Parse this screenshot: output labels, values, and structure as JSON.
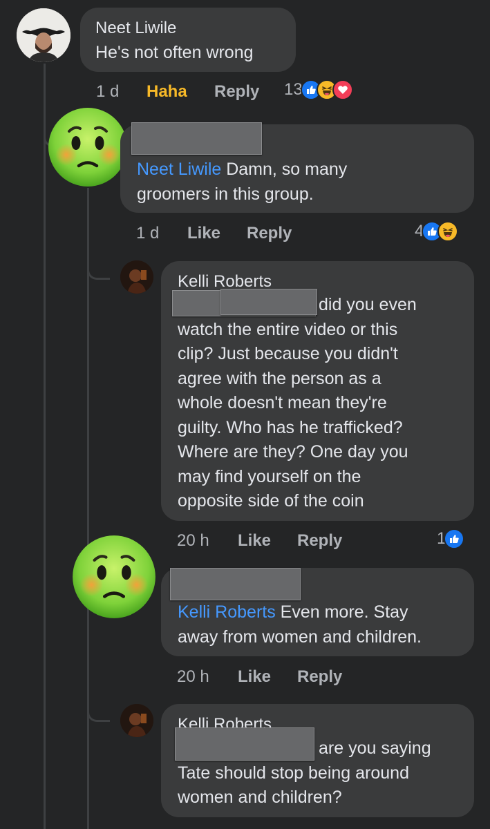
{
  "comments": [
    {
      "author": "Neet Liwile",
      "text": "He's not often wrong",
      "time": "1 d",
      "reaction_label": "Haha",
      "reply_label": "Reply",
      "reaction_count": "13",
      "reaction_icons": [
        "like-icon",
        "haha-icon",
        "love-icon"
      ]
    },
    {
      "author": "",
      "mention": "Neet Liwile",
      "text_line1": " Damn, so many",
      "text_line2": "groomers in this group.",
      "time": "1 d",
      "like_label": "Like",
      "reply_label": "Reply",
      "reaction_count": "4",
      "reaction_icons": [
        "like-icon",
        "haha-icon"
      ]
    },
    {
      "author": "Kelli Roberts",
      "text_lines": [
        "did you even",
        "watch the entire video or this",
        "clip? Just because you didn't",
        "agree with the person as a",
        "whole doesn't mean they're",
        "guilty. Who has he trafficked?",
        "Where are they? One day you",
        "may find yourself on the",
        "opposite side of the coin"
      ],
      "time": "20 h",
      "like_label": "Like",
      "reply_label": "Reply",
      "reaction_count": "1",
      "reaction_icons": [
        "like-icon"
      ]
    },
    {
      "author": "",
      "mention": "Kelli Roberts",
      "text_line1": " Even more. Stay",
      "text_line2": "away from women and children.",
      "time": "20 h",
      "like_label": "Like",
      "reply_label": "Reply"
    },
    {
      "author": "Kelli Roberts",
      "text_lines": [
        "are you saying",
        "Tate should stop being around",
        "women and children?"
      ]
    }
  ],
  "colors": {
    "background": "#242526",
    "bubble": "#3a3b3c",
    "mention": "#4599ff",
    "haha_active": "#f7b928",
    "like_blue": "#1877f2"
  }
}
